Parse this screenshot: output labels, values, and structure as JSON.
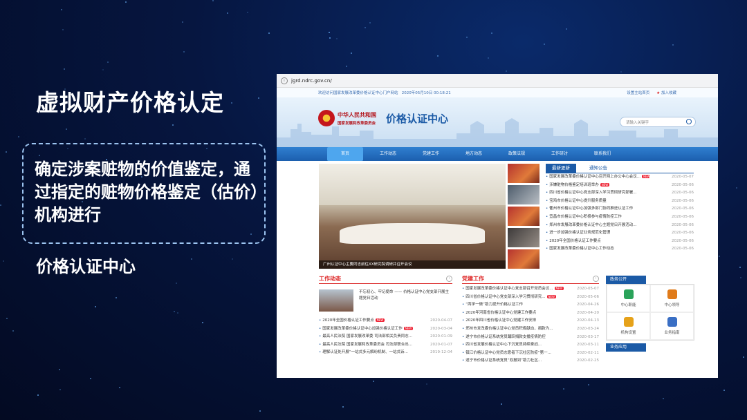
{
  "slide": {
    "title": "虚拟财产价格认定",
    "callout": "确定涉案赃物的价值鉴定，通过指定的赃物价格鉴定（估价）机构进行",
    "subtitle": "价格认证中心"
  },
  "browser": {
    "url": "jgrd.ndrc.gov.cn/"
  },
  "site": {
    "welcome": "欢迎访问国家发展改革委价格认证中心门户网站",
    "datetime": "2020年05月10日 00:18:21",
    "set_home": "设置主站首页",
    "add_fav": "加入收藏",
    "org_line1": "中华人民共和国",
    "org_line2": "国家发展和改革委员会",
    "brand": "价格认证中心",
    "search_placeholder": "请输入关键字",
    "nav": [
      "首页",
      "工作动态",
      "党建工作",
      "地方动态",
      "政策法规",
      "工作研讨",
      "联系我们"
    ],
    "photo_caption": "广州认证中心主要同志前往XX研究院调研并召开会议",
    "news_tabs": [
      "最新更新",
      "通知公告"
    ],
    "news": [
      {
        "t": "国家发展改革委价格认证中心召开网上办公中心会议...",
        "d": "2020-05-07",
        "new": true
      },
      {
        "t": "涉嫌赃物价格鉴定培训班举办",
        "d": "2020-05-06",
        "new": true
      },
      {
        "t": "四川省价格认证中心党支部深入学习贯彻研究部署...",
        "d": "2020-05-06",
        "new": false
      },
      {
        "t": "宝鸡市价格认证中心提升服务质量",
        "d": "2020-05-06",
        "new": false
      },
      {
        "t": "衢州市价格认证中心加强多部门协同推进认证工作",
        "d": "2020-05-06",
        "new": false
      },
      {
        "t": "宜昌市价格认证中心积极参与疫情防控工作",
        "d": "2020-05-06",
        "new": false
      },
      {
        "t": "郑州市发展改革委价格认证中心主题党日开展活动...",
        "d": "2020-05-06",
        "new": false
      },
      {
        "t": "进一步加强价格认证业务规范化管理",
        "d": "2020-05-06",
        "new": false
      },
      {
        "t": "2020年全国价格认证工作要点",
        "d": "2020-05-06",
        "new": false
      },
      {
        "t": "国家发展改革委价格认证中心工作动态",
        "d": "2020-05-06",
        "new": false
      }
    ],
    "work_section": "工作动态",
    "feature_text": "不忘初心、牢记使命 —— 价格认证中心党支部开展主题党日活动",
    "work_news": [
      {
        "t": "2020年全国价格认证工作要点",
        "d": "2020-04-07",
        "new": true
      },
      {
        "t": "国家发展改革委价格认证中心加强价格认证工作",
        "d": "2020-03-04",
        "new": true
      },
      {
        "t": "最高人民法院 国家发展改革委 司法部相关负责同志...",
        "d": "2020-01-09",
        "new": false
      },
      {
        "t": "最高人民法院 国家发展和改革委员会 司法部联合出...",
        "d": "2020-01-07",
        "new": false
      },
      {
        "t": "理解认证处开展“一站式多元解纷机制、一站式诉...",
        "d": "2019-12-04",
        "new": false
      }
    ],
    "party_section": "党建工作",
    "party_news": [
      {
        "t": "国家发展改革委价格认证中心党支部召开党员会议...",
        "d": "2020-05-07",
        "new": true
      },
      {
        "t": "四川省价格认证中心党支部深入学习贯彻研究...",
        "d": "2020-05-06",
        "new": true
      },
      {
        "t": "“两学一做”助力提升价格认证工作",
        "d": "2020-04-26",
        "new": false
      },
      {
        "t": "2020年河南省价格认证中心党建工作要点",
        "d": "2020-04-20",
        "new": false
      },
      {
        "t": "2020年四川省价格认证中心党建工作安排",
        "d": "2020-04-13",
        "new": false
      },
      {
        "t": "郑州市发改委价格认证中心党员积极献血，捐款为...",
        "d": "2020-03-24",
        "new": false
      },
      {
        "t": "遂宁市价格认证系统党员踊跃捐款支援疫情防控",
        "d": "2020-03-17",
        "new": false
      },
      {
        "t": "四川省发展价格认证中心下沉党员持续奋战...",
        "d": "2020-03-11",
        "new": false
      },
      {
        "t": "镇江价格认证中心党员志愿者下沉社区防疫“第一...",
        "d": "2020-02-11",
        "new": false
      },
      {
        "t": "遂宁市价格认证系统党员“双报到”助力社区...",
        "d": "2020-02-25",
        "new": false
      }
    ],
    "gov_affairs": "政务公开",
    "gov_items": [
      "中心职能",
      "中心领导",
      "机构设置",
      "业务指南"
    ],
    "biz_app": "业务应用"
  },
  "colors": {
    "accent": "#1b5aa6",
    "red": "#d22222"
  }
}
